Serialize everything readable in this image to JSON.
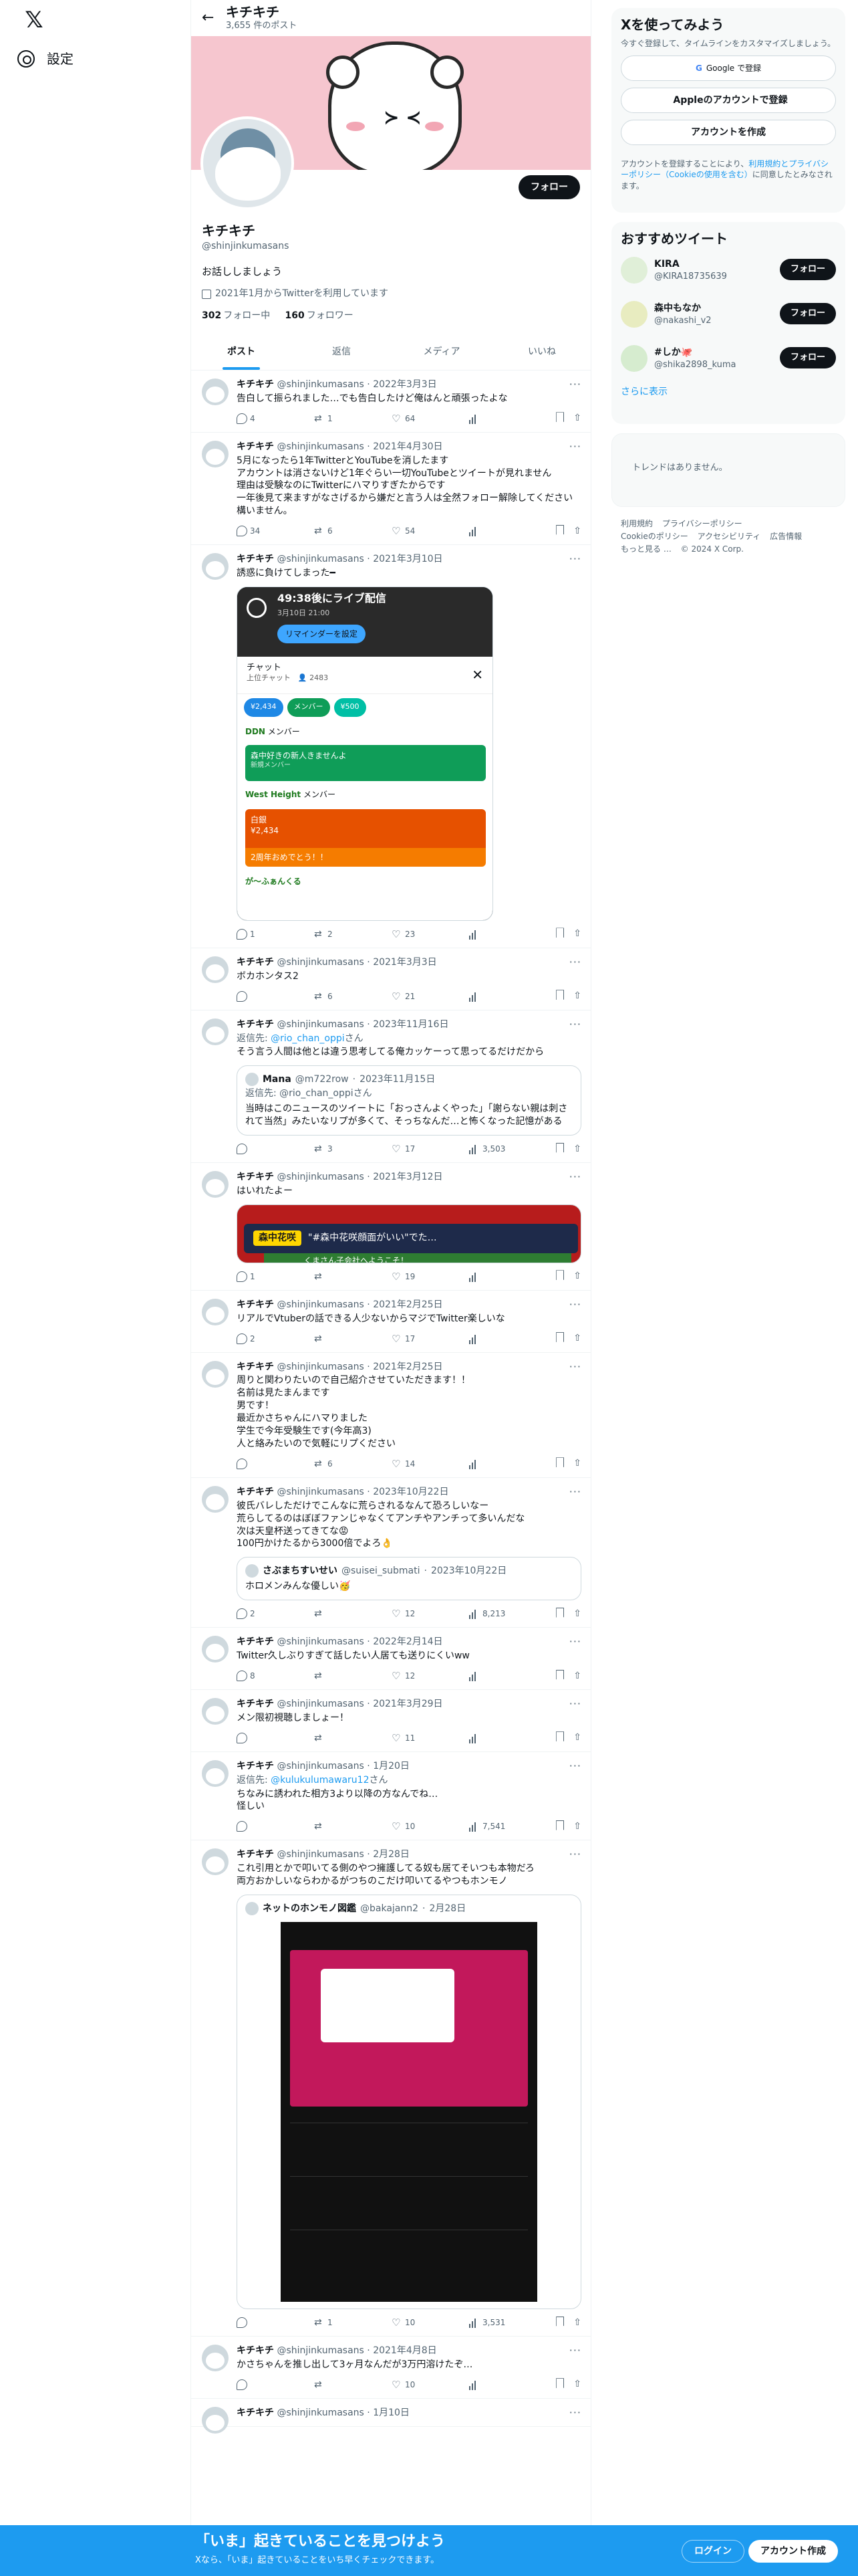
{
  "nav": {
    "logo": "𝕏",
    "settings": "設定"
  },
  "header": {
    "name": "キチキチ",
    "post_count": "3,655 件のポスト"
  },
  "profile": {
    "name": "キチキチ",
    "handle": "@shinjinkumasans",
    "follow": "フォロー",
    "bio": "お話ししましょう",
    "joined": "2021年1月からTwitterを利用しています",
    "following_count": "302",
    "following_label": "フォロー中",
    "followers_count": "160",
    "followers_label": "フォロワー"
  },
  "tabs": [
    "ポスト",
    "返信",
    "メディア",
    "いいね"
  ],
  "tweets": [
    {
      "name": "キチキチ",
      "handle": "@shinjinkumasans",
      "date": "2022年3月3日",
      "text": "告白して振られました…でも告白したけど俺はんと頑張ったよな",
      "reply": "4",
      "rt": "1",
      "like": "64",
      "views": ""
    },
    {
      "name": "キチキチ",
      "handle": "@shinjinkumasans",
      "date": "2021年4月30日",
      "text": "5月になったら1年TwitterとYouTubeを消したます\nアカウントは消さないけど1年ぐらい一切YouTubeとツイートが見れません\n理由は受験なのにTwitterにハマりすぎたからです\n一年後見て来ますがなさげるから嫌だと言う人は全然フォロー解除してください構いません。",
      "reply": "34",
      "rt": "6",
      "like": "54",
      "views": ""
    },
    {
      "name": "キチキチ",
      "handle": "@shinjinkumasans",
      "date": "2021年3月10日",
      "text": "誘惑に負けてしまった━",
      "reply": "1",
      "rt": "2",
      "like": "23",
      "views": ""
    },
    {
      "name": "キチキチ",
      "handle": "@shinjinkumasans",
      "date": "2021年3月3日",
      "text": "ボカホンタス2",
      "reply": "",
      "rt": "6",
      "like": "21",
      "views": ""
    },
    {
      "name": "キチキチ",
      "handle": "@shinjinkumasans",
      "date": "2023年11月16日",
      "text": "そう言う人間は他とは違う思考してる俺カッケーって思ってるだけだから",
      "reply": "",
      "rt": "3",
      "like": "17",
      "views": "3,503"
    },
    {
      "name": "キチキチ",
      "handle": "@shinjinkumasans",
      "date": "2021年3月12日",
      "text": "はいれたよー",
      "reply": "1",
      "rt": "",
      "like": "19",
      "views": ""
    },
    {
      "name": "キチキチ",
      "handle": "@shinjinkumasans",
      "date": "2021年2月25日",
      "text": "リアルでVtuberの話できる人少ないからマジでTwitter楽しいな",
      "reply": "2",
      "rt": "",
      "like": "17",
      "views": ""
    },
    {
      "name": "キチキチ",
      "handle": "@shinjinkumasans",
      "date": "2021年2月25日",
      "text": "周りと関わりたいので自己紹介させていただきます！！\n名前は見たまんまです\n男です！\n最近かさちゃんにハマりました\n学生で今年受験生です(今年高3)\n人と絡みたいので気軽にリプください",
      "reply": "",
      "rt": "6",
      "like": "14",
      "views": ""
    },
    {
      "name": "キチキチ",
      "handle": "@shinjinkumasans",
      "date": "2023年10月22日",
      "text": "彼氏バレしただけでこんなに荒らされるなんて恐ろしいなー\n荒らしてるのはぼぼファンじゃなくてアンチやアンチって多いんだな\n次は天皇杯送ってきてな😡\n100円かけたるから3000倍でよろ👌",
      "reply": "2",
      "rt": "",
      "like": "12",
      "views": "8,213"
    },
    {
      "name": "キチキチ",
      "handle": "@shinjinkumasans",
      "date": "2022年2月14日",
      "text": "Twitter久しぶりすぎて話したい人居ても送りにくいww",
      "reply": "8",
      "rt": "",
      "like": "12",
      "views": ""
    },
    {
      "name": "キチキチ",
      "handle": "@shinjinkumasans",
      "date": "2021年3月29日",
      "text": "メン限初視聴しましょー！",
      "reply": "",
      "rt": "",
      "like": "11",
      "views": ""
    },
    {
      "name": "キチキチ",
      "handle": "@shinjinkumasans",
      "date": "1月20日",
      "text": "ちなみに誘われた相方3より以降の方なんでね…\n怪しい",
      "reply": "",
      "rt": "",
      "like": "10",
      "views": "7,541"
    },
    {
      "name": "キチキチ",
      "handle": "@shinjinkumasans",
      "date": "2月28日",
      "text": "これ引用とかで叩いてる側のやつ擁護してる奴も居てそいつも本物だろ\n両方おかしいならわかるがつちのこだけ叩いてるやつもホンモノ",
      "reply": "",
      "rt": "1",
      "like": "10",
      "views": "3,531"
    },
    {
      "name": "キチキチ",
      "handle": "@shinjinkumasans",
      "date": "2021年4月8日",
      "text": "かさちゃんを推し出して3ヶ月なんだが3万円溶けたぞ…",
      "reply": "",
      "rt": "",
      "like": "10",
      "views": ""
    },
    {
      "name": "キチキチ",
      "handle": "@shinjinkumasans",
      "date": "1月10日",
      "text": "",
      "reply": "",
      "rt": "",
      "like": "",
      "views": ""
    }
  ],
  "reply_to": {
    "t5": {
      "label": "返信先: ",
      "to": "@rio_chan_oppi",
      "suffix": "さん"
    },
    "t12": {
      "label": "返信先: ",
      "to": "@kulukulumawaru12",
      "suffix": "さん"
    }
  },
  "quotes": {
    "q5": {
      "name": "Mana",
      "handle": "@m722row",
      "date": "2023年11月15日",
      "reply_label": "返信先: @rio_chan_oppiさん",
      "text": "当時はこのニュースのツイートに「おっさんよくやった」「謝らない親は刺されて当然」みたいなリプが多くて、そっちなんだ…と怖くなった記憶がある"
    },
    "q9": {
      "name": "さぶまちすいせい",
      "handle": "@suisei_submati",
      "date": "2023年10月22日",
      "text": "ホロメンみんな優しい🥳"
    },
    "q13": {
      "name": "ネットのホンモノ図鑑",
      "handle": "@bakajann2",
      "date": "2月28日"
    }
  },
  "media_stream": {
    "live": "49:38後にライブ配信",
    "sub": "3月10日 21:00",
    "reminder": "リマインダーを設定",
    "chat": "チャット",
    "chat_sub": "上位チャット",
    "viewers": "2483",
    "chips": [
      "¥2,434",
      "メンバー",
      "¥500"
    ],
    "msg1_user": "DDN",
    "msg1_text": "メンバー",
    "green_name": "森中好きの新人きませんよ",
    "green_sub": "新規メンバー",
    "msg2_user": "West Height",
    "msg2_text": "メンバー",
    "orange_name": "白銀",
    "orange_amt": "¥2,434",
    "orange_msg": "2周年おめでとう！！",
    "msg3_user": "が〜ふぁんくる"
  },
  "media_banner": {
    "tag": "森中花咲",
    "text": "\"#森中花咲顔面がいい\"でた…",
    "green": "くまさん子会社へようこそ！"
  },
  "right": {
    "title": "Xを使ってみよう",
    "sub": "今すぐ登録して、タイムラインをカスタマイズしましょう。",
    "google": "Google で登録",
    "apple": "Appleのアカウントで登録",
    "create": "アカウントを作成",
    "terms_a": "アカウントを登録することにより、",
    "terms_b": "利用規約とプライバシーポリシー（Cookieの使用を含む）",
    "terms_c": "に同意したとみなされます。",
    "sug_title": "おすすめツイート",
    "suggestions": [
      {
        "name": "KIRA",
        "handle": "@KIRA18735639",
        "btn": "フォロー"
      },
      {
        "name": "森中もなか",
        "handle": "@nakashi_v2",
        "btn": "フォロー"
      },
      {
        "name": "#しか🐙",
        "handle": "@shika2898_kuma",
        "btn": "フォロー"
      }
    ],
    "more": "さらに表示",
    "trends": "トレンドはありません。",
    "footer": [
      "利用規約",
      "プライバシーポリシー",
      "Cookieのポリシー",
      "アクセシビリティ",
      "広告情報",
      "もっと見る …",
      "© 2024 X Corp."
    ]
  },
  "bottom": {
    "title": "「いま」起きていることを見つけよう",
    "sub": "Xなら、「いま」起きていることをいち早くチェックできます。",
    "login": "ログイン",
    "signup": "アカウント作成"
  }
}
